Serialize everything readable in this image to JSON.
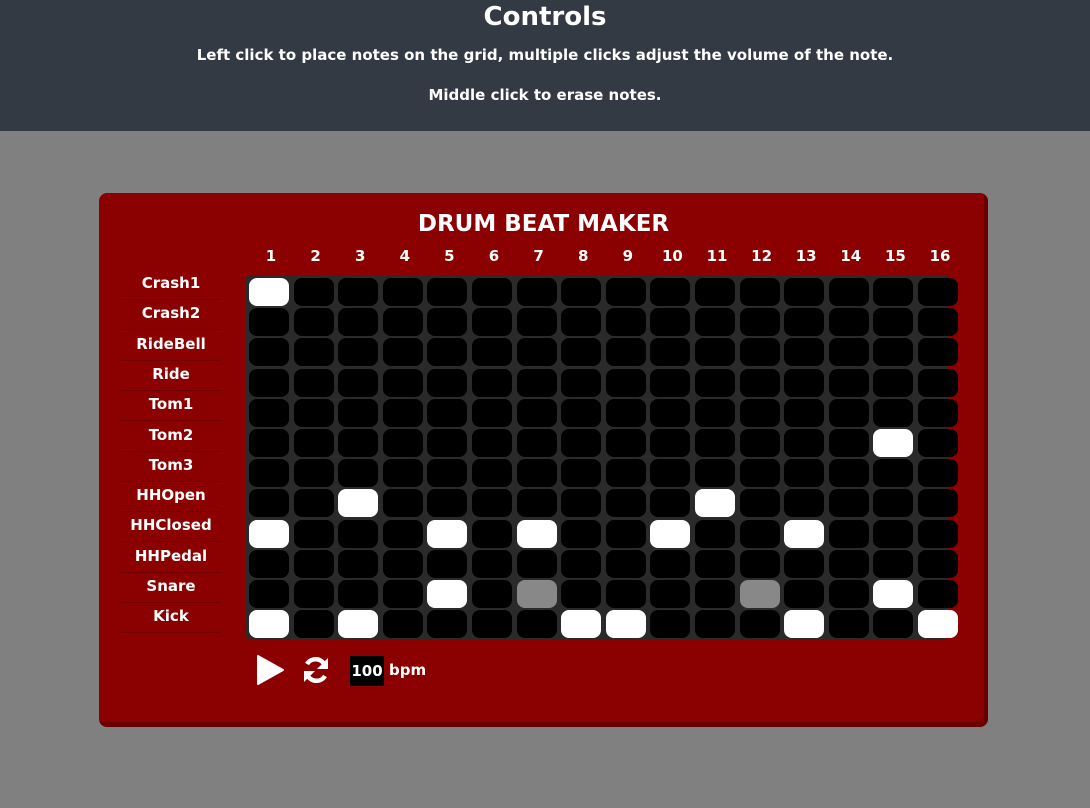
{
  "header": {
    "title": "Controls",
    "line1": "Left click to place notes on the grid, multiple clicks adjust the volume of the note.",
    "line2": "Middle click to erase notes."
  },
  "beat_maker": {
    "title": "DRUM BEAT MAKER",
    "columns": [
      "1",
      "2",
      "3",
      "4",
      "5",
      "6",
      "7",
      "8",
      "9",
      "10",
      "11",
      "12",
      "13",
      "14",
      "15",
      "16"
    ],
    "rows": [
      {
        "label": "Crash1",
        "cells": [
          2,
          0,
          0,
          0,
          0,
          0,
          0,
          0,
          0,
          0,
          0,
          0,
          0,
          0,
          0,
          0
        ]
      },
      {
        "label": "Crash2",
        "cells": [
          0,
          0,
          0,
          0,
          0,
          0,
          0,
          0,
          0,
          0,
          0,
          0,
          0,
          0,
          0,
          0
        ]
      },
      {
        "label": "RideBell",
        "cells": [
          0,
          0,
          0,
          0,
          0,
          0,
          0,
          0,
          0,
          0,
          0,
          0,
          0,
          0,
          0,
          0
        ]
      },
      {
        "label": "Ride",
        "cells": [
          0,
          0,
          0,
          0,
          0,
          0,
          0,
          0,
          0,
          0,
          0,
          0,
          0,
          0,
          0,
          0
        ]
      },
      {
        "label": "Tom1",
        "cells": [
          0,
          0,
          0,
          0,
          0,
          0,
          0,
          0,
          0,
          0,
          0,
          0,
          0,
          0,
          0,
          0
        ]
      },
      {
        "label": "Tom2",
        "cells": [
          0,
          0,
          0,
          0,
          0,
          0,
          0,
          0,
          0,
          0,
          0,
          0,
          0,
          0,
          2,
          0
        ]
      },
      {
        "label": "Tom3",
        "cells": [
          0,
          0,
          0,
          0,
          0,
          0,
          0,
          0,
          0,
          0,
          0,
          0,
          0,
          0,
          0,
          0
        ]
      },
      {
        "label": "HHOpen",
        "cells": [
          0,
          0,
          2,
          0,
          0,
          0,
          0,
          0,
          0,
          0,
          2,
          0,
          0,
          0,
          0,
          0
        ]
      },
      {
        "label": "HHClosed",
        "cells": [
          2,
          0,
          0,
          0,
          2,
          0,
          2,
          0,
          0,
          2,
          0,
          0,
          2,
          0,
          0,
          0
        ]
      },
      {
        "label": "HHPedal",
        "cells": [
          0,
          0,
          0,
          0,
          0,
          0,
          0,
          0,
          0,
          0,
          0,
          0,
          0,
          0,
          0,
          0
        ]
      },
      {
        "label": "Snare",
        "cells": [
          0,
          0,
          0,
          0,
          2,
          0,
          1,
          0,
          0,
          0,
          0,
          1,
          0,
          0,
          2,
          0
        ]
      },
      {
        "label": "Kick",
        "cells": [
          2,
          0,
          2,
          0,
          0,
          0,
          0,
          2,
          2,
          0,
          0,
          0,
          2,
          0,
          0,
          2
        ]
      }
    ],
    "note_levels": {
      "0": "empty",
      "1": "low-volume",
      "2": "full-volume"
    },
    "colors": {
      "panel": "#8b0000",
      "empty_cell": "#000000",
      "low_volume_cell": "#888888",
      "full_volume_cell": "#ffffff"
    }
  },
  "transport": {
    "play_icon": "play-icon",
    "loop_icon": "loop-icon",
    "bpm_value": "100",
    "bpm_label": "bpm"
  }
}
